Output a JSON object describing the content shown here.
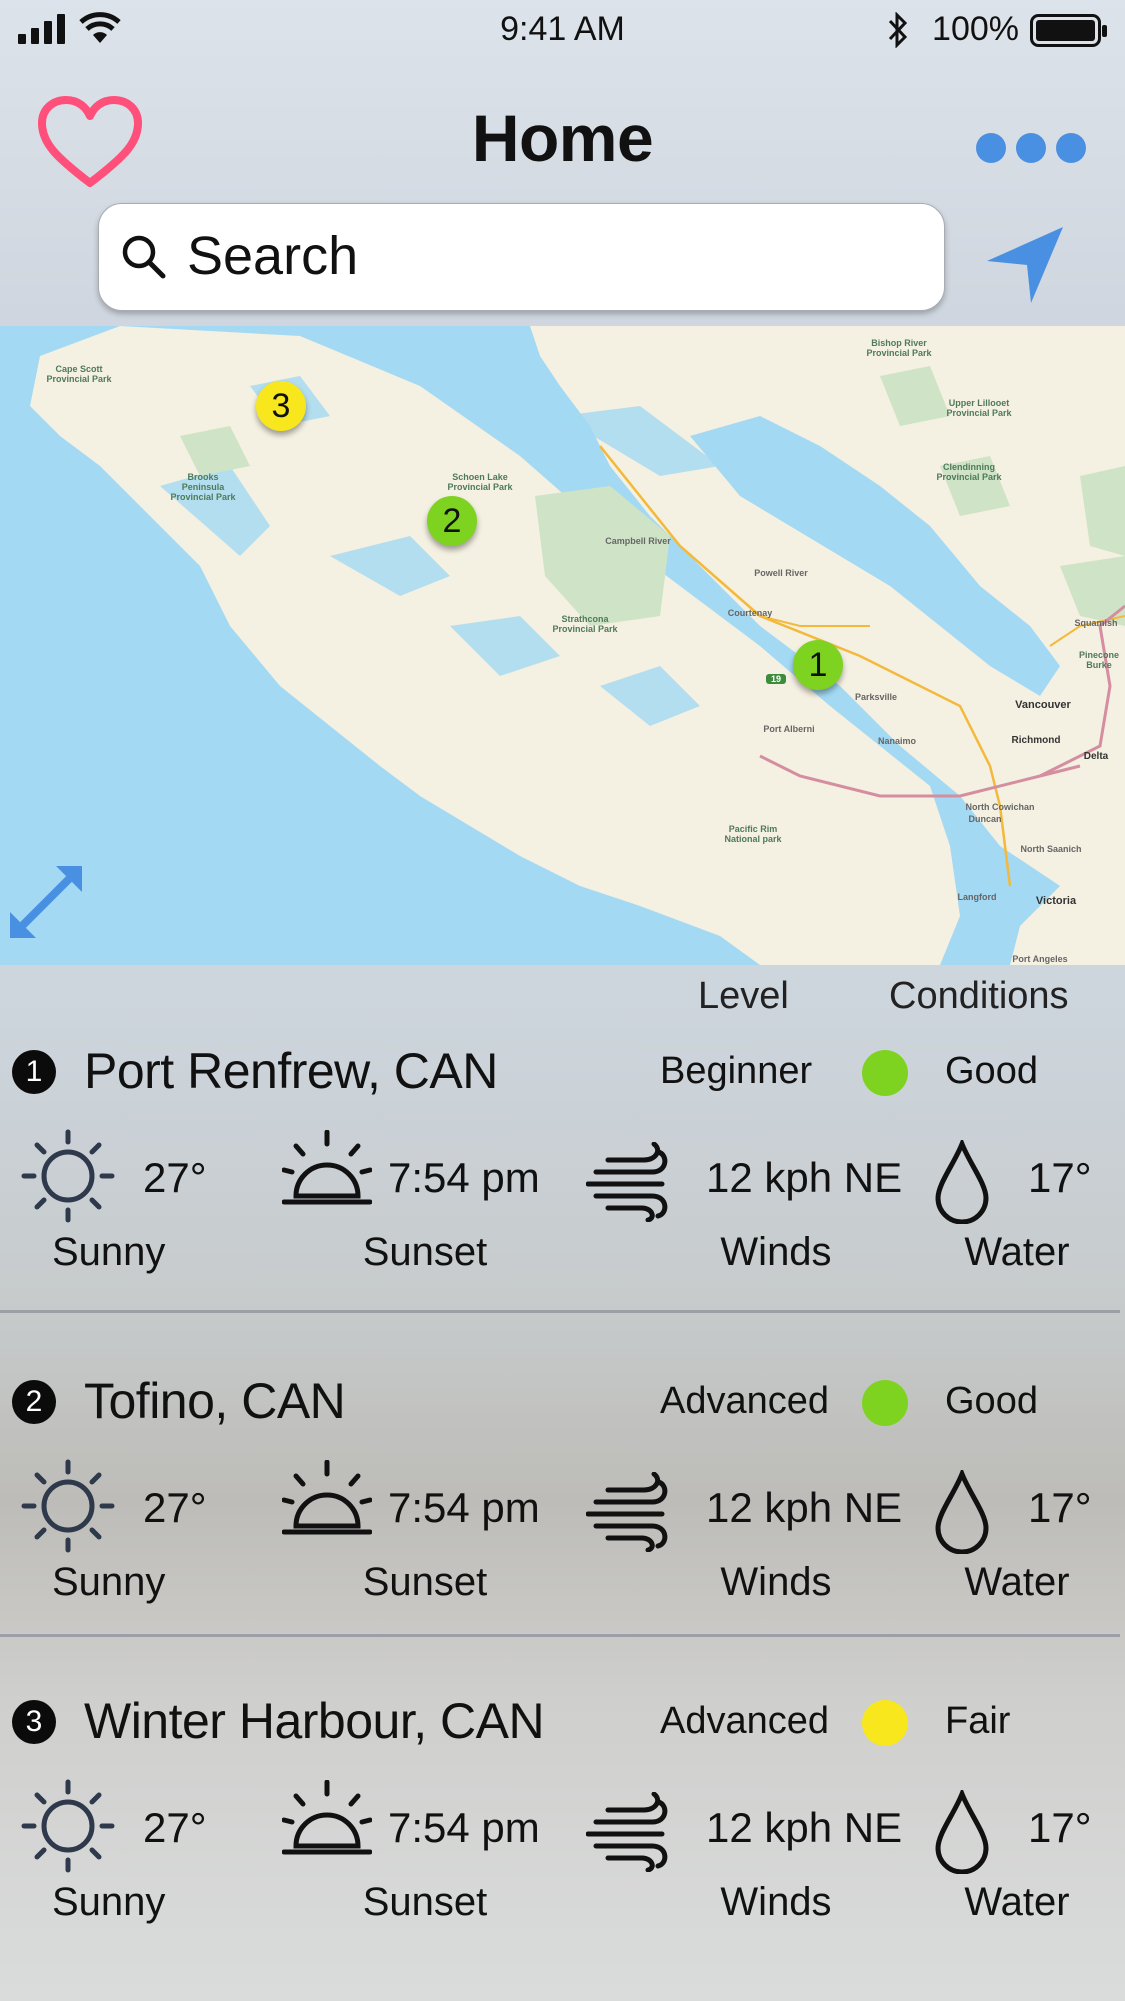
{
  "status_bar": {
    "time": "9:41 AM",
    "battery": "100%"
  },
  "header": {
    "title": "Home"
  },
  "search": {
    "placeholder": "Search"
  },
  "map": {
    "markers": [
      {
        "label": "1",
        "color": "#7ed321"
      },
      {
        "label": "2",
        "color": "#7ed321"
      },
      {
        "label": "3",
        "color": "#f8e71c"
      }
    ],
    "place_labels": {
      "cape_scott": "Cape Scott Provincial Park",
      "brooks": "Brooks Peninsula Provincial Park",
      "schoen": "Schoen Lake Provincial Park",
      "campbell": "Campbell River",
      "powell": "Powell River",
      "strathcona": "Strathcona Provincial Park",
      "courtenay": "Courtenay",
      "parksville": "Parksville",
      "port_alberni": "Port Alberni",
      "nanaimo": "Nanaimo",
      "vancouver": "Vancouver",
      "richmond": "Richmond",
      "delta": "Delta",
      "pacific_rim": "Pacific Rim National park",
      "north_cowichan": "North Cowichan",
      "duncan": "Duncan",
      "north_saanich": "North Saanich",
      "langford": "Langford",
      "victoria": "Victoria",
      "bishop_river": "Bishop River Provincial Park",
      "upper_lillooet": "Upper Lillooet Provincial Park",
      "clendinning": "Clendinning Provincial Park",
      "squamish": "Squamish",
      "pinecone": "Pinecone Burke",
      "port_angeles": "Port Angeles",
      "highway": "19"
    }
  },
  "columns": {
    "level": "Level",
    "conditions": "Conditions"
  },
  "spots": [
    {
      "number": "1",
      "name": "Port Renfrew, CAN",
      "level": "Beginner",
      "condition": "Good",
      "condition_color": "#7ed321",
      "temp": "27°",
      "weather": "Sunny",
      "sunset_time": "7:54 pm",
      "sunset_label": "Sunset",
      "wind": "12 kph NE",
      "wind_label": "Winds",
      "water_temp": "17°",
      "water_label": "Water"
    },
    {
      "number": "2",
      "name": "Tofino, CAN",
      "level": "Advanced",
      "condition": "Good",
      "condition_color": "#7ed321",
      "temp": "27°",
      "weather": "Sunny",
      "sunset_time": "7:54 pm",
      "sunset_label": "Sunset",
      "wind": "12 kph NE",
      "wind_label": "Winds",
      "water_temp": "17°",
      "water_label": "Water"
    },
    {
      "number": "3",
      "name": "Winter Harbour, CAN",
      "level": "Advanced",
      "condition": "Fair",
      "condition_color": "#f8e71c",
      "temp": "27°",
      "weather": "Sunny",
      "sunset_time": "7:54 pm",
      "sunset_label": "Sunset",
      "wind": "12 kph NE",
      "wind_label": "Winds",
      "water_temp": "17°",
      "water_label": "Water"
    }
  ],
  "colors": {
    "accent": "#4a90e2",
    "favorite": "#ff4f7b",
    "good": "#7ed321",
    "fair": "#f8e71c"
  },
  "icons": [
    "signal-icon",
    "wifi-icon",
    "bluetooth-icon",
    "battery-icon",
    "heart-icon",
    "more-icon",
    "search-icon",
    "location-arrow-icon",
    "expand-icon",
    "sun-icon",
    "sunset-icon",
    "wind-icon",
    "water-drop-icon"
  ]
}
